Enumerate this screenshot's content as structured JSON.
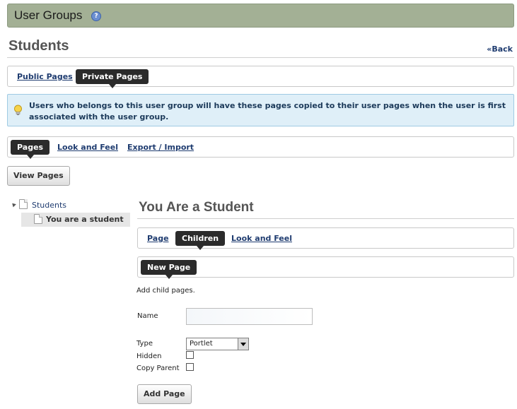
{
  "header": {
    "title": "User Groups",
    "help_icon": "help-icon"
  },
  "group": {
    "name": "Students",
    "back_label": "«Back"
  },
  "page_tabs": {
    "public": "Public Pages",
    "private": "Private Pages"
  },
  "info": {
    "icon": "lightbulb-icon",
    "message": "Users who belongs to this user group will have these pages copied to their user pages when the user is first associated with the user group."
  },
  "section_tabs": {
    "pages": "Pages",
    "look_and_feel": "Look and Feel",
    "export_import": "Export / Import"
  },
  "view_pages_label": "View Pages",
  "tree": {
    "root": {
      "label": "Students",
      "icon": "document-icon"
    },
    "child": {
      "label": "You are a student",
      "icon": "document-icon"
    }
  },
  "page": {
    "heading": "You Are a Student",
    "tabs": {
      "page": "Page",
      "children": "Children",
      "look_and_feel": "Look and Feel"
    },
    "subtab": "New Page",
    "description": "Add child pages.",
    "form": {
      "name_label": "Name",
      "name_value": "",
      "type_label": "Type",
      "type_value": "Portlet",
      "hidden_label": "Hidden",
      "hidden_checked": false,
      "copy_parent_label": "Copy Parent",
      "copy_parent_checked": false
    },
    "add_button": "Add Page"
  },
  "colors": {
    "header_bg": "#a3b095",
    "active_tab": "#2b2b2b",
    "info_bg": "#dfeff8",
    "link": "#1f3c70"
  }
}
